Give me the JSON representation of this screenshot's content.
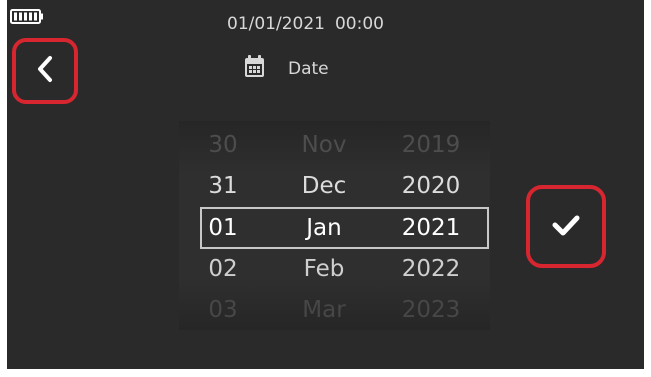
{
  "status": {
    "battery_icon": "battery-full-icon"
  },
  "header": {
    "date": "01/01/2021",
    "time": "00:00",
    "mode_icon": "calendar-icon",
    "mode_label": "Date"
  },
  "buttons": {
    "back_icon": "chevron-left-icon",
    "confirm_icon": "checkmark-icon",
    "highlight_color": "#d7262f"
  },
  "picker": {
    "selected_index": 2,
    "rows": [
      {
        "day": "30",
        "month": "Nov",
        "year": "2019"
      },
      {
        "day": "31",
        "month": "Dec",
        "year": "2020"
      },
      {
        "day": "01",
        "month": "Jan",
        "year": "2021"
      },
      {
        "day": "02",
        "month": "Feb",
        "year": "2022"
      },
      {
        "day": "03",
        "month": "Mar",
        "year": "2023"
      }
    ]
  },
  "colors": {
    "background": "#2a2a2a",
    "text": "#d8d8d8",
    "selection_border": "#c8c8c8"
  }
}
